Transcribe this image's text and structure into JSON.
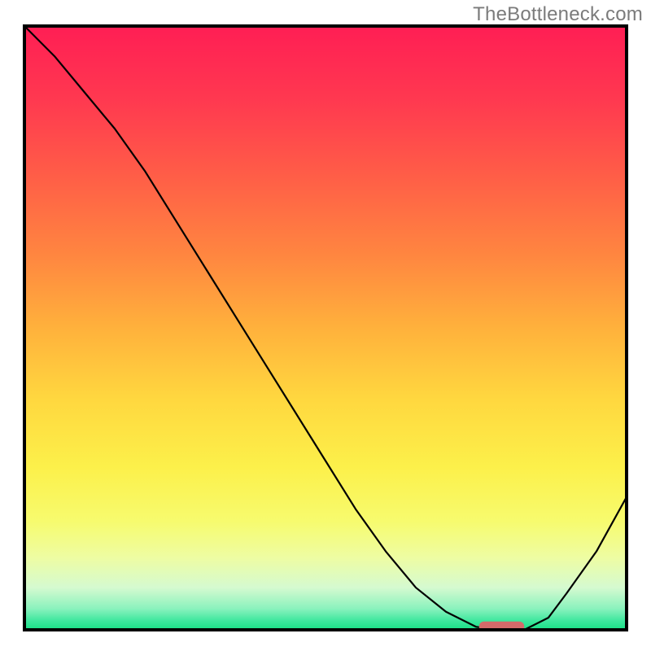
{
  "watermark": "TheBottleneck.com",
  "chart_data": {
    "type": "line",
    "x": [
      0.0,
      0.05,
      0.1,
      0.15,
      0.2,
      0.25,
      0.3,
      0.35,
      0.4,
      0.45,
      0.5,
      0.55,
      0.6,
      0.65,
      0.7,
      0.75,
      0.79,
      0.83,
      0.87,
      0.9,
      0.95,
      1.0
    ],
    "values": [
      1.0,
      0.95,
      0.89,
      0.83,
      0.76,
      0.68,
      0.6,
      0.52,
      0.44,
      0.36,
      0.28,
      0.2,
      0.13,
      0.07,
      0.03,
      0.005,
      0.0,
      0.0,
      0.02,
      0.06,
      0.13,
      0.22
    ],
    "title": "",
    "xlabel": "",
    "ylabel": "",
    "xlim": [
      0,
      1
    ],
    "ylim": [
      0,
      1
    ],
    "marker": {
      "x_range": [
        0.755,
        0.83
      ],
      "y": 0.005
    },
    "background_gradient": {
      "type": "vertical",
      "stops": [
        {
          "pos": 0.0,
          "color": "#ff1e54"
        },
        {
          "pos": 0.12,
          "color": "#ff3850"
        },
        {
          "pos": 0.25,
          "color": "#ff5e47"
        },
        {
          "pos": 0.38,
          "color": "#ff8640"
        },
        {
          "pos": 0.5,
          "color": "#ffb13c"
        },
        {
          "pos": 0.62,
          "color": "#ffd83f"
        },
        {
          "pos": 0.73,
          "color": "#fcf04a"
        },
        {
          "pos": 0.82,
          "color": "#f7fb6e"
        },
        {
          "pos": 0.88,
          "color": "#eefda2"
        },
        {
          "pos": 0.93,
          "color": "#d5fad0"
        },
        {
          "pos": 0.965,
          "color": "#8af2bd"
        },
        {
          "pos": 0.985,
          "color": "#3ee79e"
        },
        {
          "pos": 1.0,
          "color": "#18df85"
        }
      ]
    }
  }
}
